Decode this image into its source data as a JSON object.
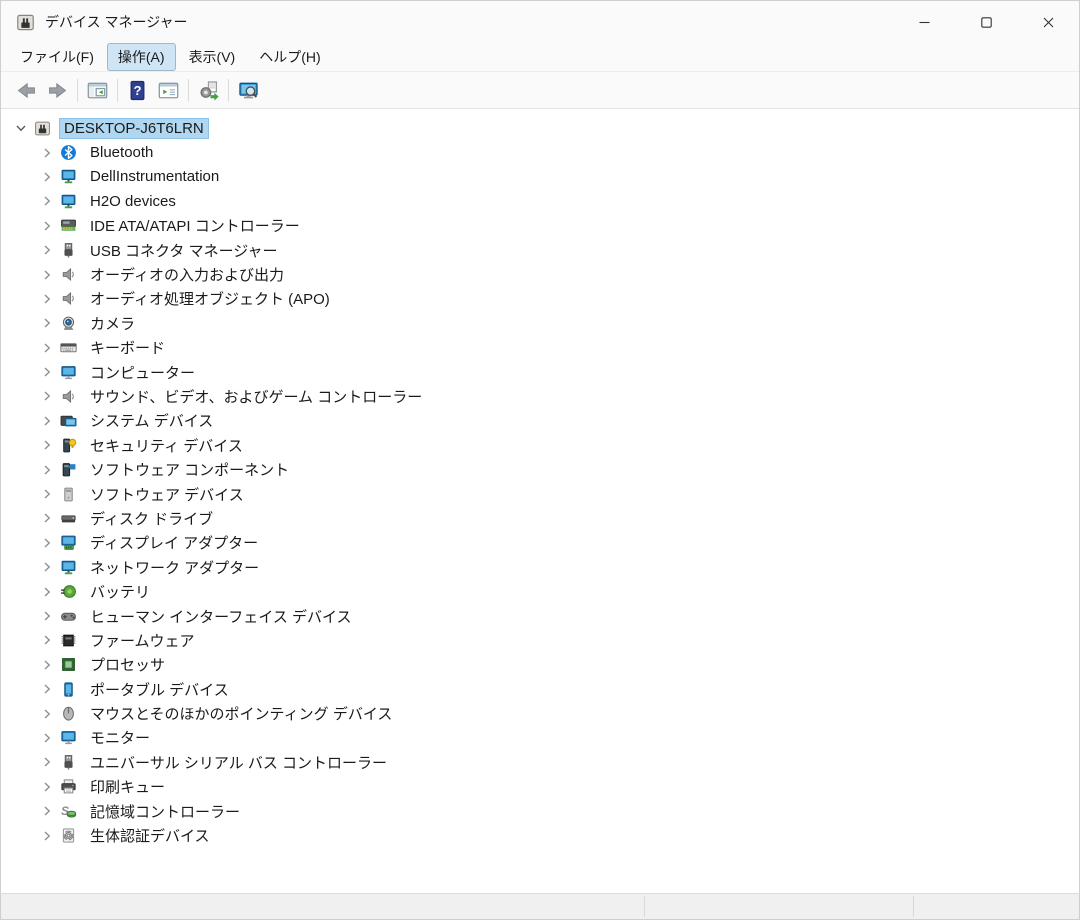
{
  "window": {
    "title": "デバイス マネージャー",
    "app_icon": "computer-icon"
  },
  "titlebar_controls": [
    {
      "name": "minimize-button",
      "icon": "minimize-icon"
    },
    {
      "name": "maximize-button",
      "icon": "maximize-icon"
    },
    {
      "name": "close-button",
      "icon": "close-icon"
    }
  ],
  "menu": {
    "items": [
      {
        "id": "file",
        "label": "ファイル(F)",
        "active": false
      },
      {
        "id": "action",
        "label": "操作(A)",
        "active": true
      },
      {
        "id": "view",
        "label": "表示(V)",
        "active": false
      },
      {
        "id": "help",
        "label": "ヘルプ(H)",
        "active": false
      }
    ]
  },
  "toolbar": {
    "buttons": [
      {
        "name": "back-button",
        "icon": "arrow-left-icon"
      },
      {
        "name": "forward-button",
        "icon": "arrow-right-icon"
      },
      {
        "sep": true
      },
      {
        "name": "console-tree-button",
        "icon": "console-tree-icon"
      },
      {
        "sep": true
      },
      {
        "name": "help-button",
        "icon": "help-icon"
      },
      {
        "name": "action-pane-button",
        "icon": "action-pane-icon"
      },
      {
        "sep": true
      },
      {
        "name": "update-driver-button",
        "icon": "update-driver-icon"
      },
      {
        "sep": true
      },
      {
        "name": "scan-devices-button",
        "icon": "scan-devices-icon"
      }
    ]
  },
  "tree": {
    "root": {
      "label": "DESKTOP-J6T6LRN",
      "icon": "computer-icon",
      "expanded": true,
      "selected": true
    },
    "items": [
      {
        "label": "Bluetooth",
        "icon": "bluetooth-icon"
      },
      {
        "label": "DellInstrumentation",
        "icon": "network-pc-icon"
      },
      {
        "label": "H2O devices",
        "icon": "network-pc-icon"
      },
      {
        "label": "IDE ATA/ATAPI コントローラー",
        "icon": "ata-controller-icon"
      },
      {
        "label": "USB コネクタ マネージャー",
        "icon": "usb-connector-icon"
      },
      {
        "label": "オーディオの入力および出力",
        "icon": "speaker-icon"
      },
      {
        "label": "オーディオ処理オブジェクト (APO)",
        "icon": "speaker-icon"
      },
      {
        "label": "カメラ",
        "icon": "camera-icon"
      },
      {
        "label": "キーボード",
        "icon": "keyboard-icon"
      },
      {
        "label": "コンピューター",
        "icon": "monitor-icon"
      },
      {
        "label": "サウンド、ビデオ、およびゲーム コントローラー",
        "icon": "speaker-icon"
      },
      {
        "label": "システム デバイス",
        "icon": "system-device-icon"
      },
      {
        "label": "セキュリティ デバイス",
        "icon": "security-device-icon"
      },
      {
        "label": "ソフトウェア コンポーネント",
        "icon": "software-component-icon"
      },
      {
        "label": "ソフトウェア デバイス",
        "icon": "software-device-icon"
      },
      {
        "label": "ディスク ドライブ",
        "icon": "disk-drive-icon"
      },
      {
        "label": "ディスプレイ アダプター",
        "icon": "display-adapter-icon"
      },
      {
        "label": "ネットワーク アダプター",
        "icon": "network-pc-icon"
      },
      {
        "label": "バッテリ",
        "icon": "battery-icon"
      },
      {
        "label": "ヒューマン インターフェイス デバイス",
        "icon": "hid-icon"
      },
      {
        "label": "ファームウェア",
        "icon": "firmware-icon"
      },
      {
        "label": "プロセッサ",
        "icon": "processor-icon"
      },
      {
        "label": "ポータブル デバイス",
        "icon": "portable-device-icon"
      },
      {
        "label": "マウスとそのほかのポインティング デバイス",
        "icon": "mouse-icon"
      },
      {
        "label": "モニター",
        "icon": "monitor-icon"
      },
      {
        "label": "ユニバーサル シリアル バス コントローラー",
        "icon": "usb-connector-icon"
      },
      {
        "label": "印刷キュー",
        "icon": "printer-icon"
      },
      {
        "label": "記憶域コントローラー",
        "icon": "storage-controller-icon"
      },
      {
        "label": "生体認証デバイス",
        "icon": "biometric-icon"
      }
    ]
  },
  "colors": {
    "selection_bg": "#b0d7f1",
    "selection_border": "#8ec1e6",
    "menu_active_bg": "#cfe4f5",
    "menu_active_border": "#9db8c9",
    "accent_blue": "#1d78bd",
    "titlebar_bg": "#fafafa",
    "tree_bg": "#ffffff",
    "statusbar_bg": "#f0f0f0"
  }
}
